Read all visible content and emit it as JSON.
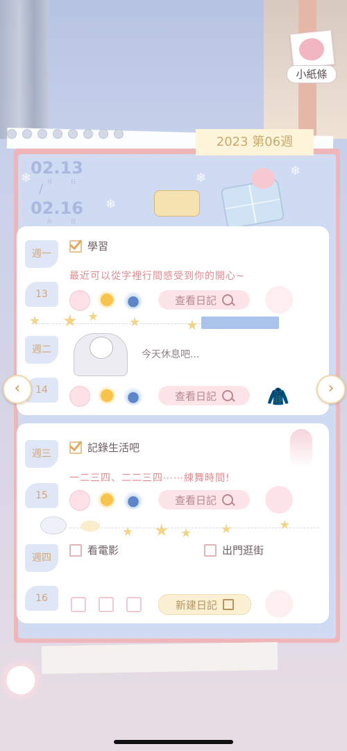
{
  "header": {
    "note_label": "小紙條",
    "week_label": "2023 第06週"
  },
  "dates": {
    "start": "02.13",
    "end": "02.16",
    "start_month": "月",
    "start_day": "日",
    "end_month": "月",
    "end_day": "日"
  },
  "days": [
    {
      "name": "週一",
      "num": "13",
      "tasks": [
        {
          "label": "學習",
          "checked": true
        }
      ],
      "diary": "最近可以從字裡行間感受到你的開心~",
      "button": "查看日記"
    },
    {
      "name": "週二",
      "num": "14",
      "tasks": [],
      "diary": "今天休息吧...",
      "button": "查看日記"
    },
    {
      "name": "週三",
      "num": "15",
      "tasks": [
        {
          "label": "記錄生活吧",
          "checked": true
        }
      ],
      "diary": "一二三四、二二三四⋯⋯練舞時間!",
      "button": "查看日記"
    },
    {
      "name": "週四",
      "num": "16",
      "tasks": [
        {
          "label": "看電影",
          "checked": false
        },
        {
          "label": "出門逛街",
          "checked": false
        }
      ],
      "button": "新建日記"
    }
  ],
  "icons": {
    "mood": "smile-face-icon",
    "weather": "sun-icon",
    "scene": "snow-globe-icon",
    "search": "magnifier-icon",
    "edit": "pen-icon"
  },
  "nav": {
    "prev": "‹",
    "next": "›"
  },
  "colors": {
    "frame": "#f0b5b8",
    "panel": "#cfdaf3",
    "accent_text": "#e08a8f",
    "tab_text": "#d4a674"
  }
}
